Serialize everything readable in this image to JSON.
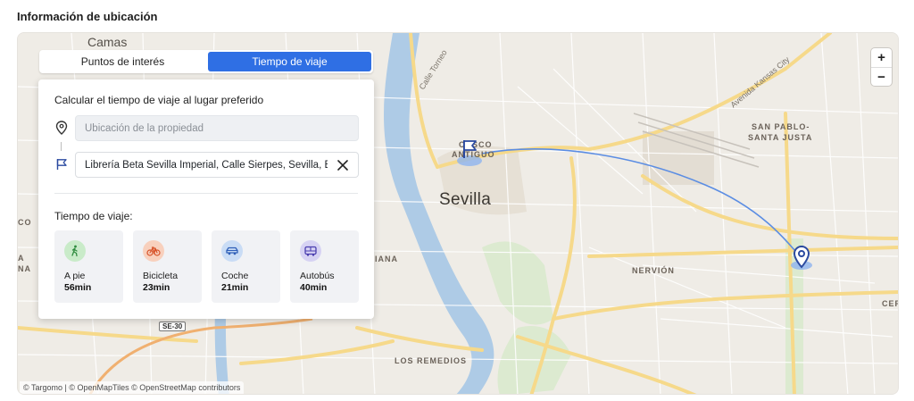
{
  "section_title": "Información de ubicación",
  "tabs": [
    {
      "label": "Puntos de interés",
      "active": false
    },
    {
      "label": "Tiempo de viaje",
      "active": true
    }
  ],
  "panel": {
    "heading": "Calcular el tiempo de viaje al lugar preferido",
    "origin_placeholder": "Ubicación de la propiedad",
    "destination_value": "Librería Beta Sevilla Imperial, Calle Sierpes, Sevilla, España",
    "travel_time_label": "Tiempo de viaje:",
    "modes": [
      {
        "name": "A pie",
        "time": "56min",
        "icon": "walking-icon",
        "color": "#c9ebc9"
      },
      {
        "name": "Bicicleta",
        "time": "23min",
        "icon": "bicycle-icon",
        "color": "#f8d0bd"
      },
      {
        "name": "Coche",
        "time": "21min",
        "icon": "car-icon",
        "color": "#c9dcf5"
      },
      {
        "name": "Autobús",
        "time": "40min",
        "icon": "bus-icon",
        "color": "#d6d2f3"
      }
    ]
  },
  "map": {
    "labels": {
      "camas": "Camas",
      "sevilla": "Sevilla",
      "casco": "CASCO",
      "antiguo": "ANTIGUO",
      "san_pablo": "SAN PABLO-",
      "santa_justa": "SANTA JUSTA",
      "nervion": "NERVIÓN",
      "los_remedios": "LOS REMEDIOS",
      "triana": "IANA",
      "calle_torneo": "Calle Torneo",
      "avenida_kansas": "Avenida Kansas City",
      "se30": "SE-30",
      "edge_co": "CO",
      "edge_a": "A",
      "edge_na": "NA",
      "edge_cer": "CER"
    },
    "zoom_in": "+",
    "zoom_out": "−",
    "attribution": "© Targomo | © OpenMapTiles © OpenStreetMap contributors"
  },
  "colors": {
    "accent": "#2f6fe4",
    "route": "#5b8de3",
    "marker": "#2b4aa0"
  }
}
